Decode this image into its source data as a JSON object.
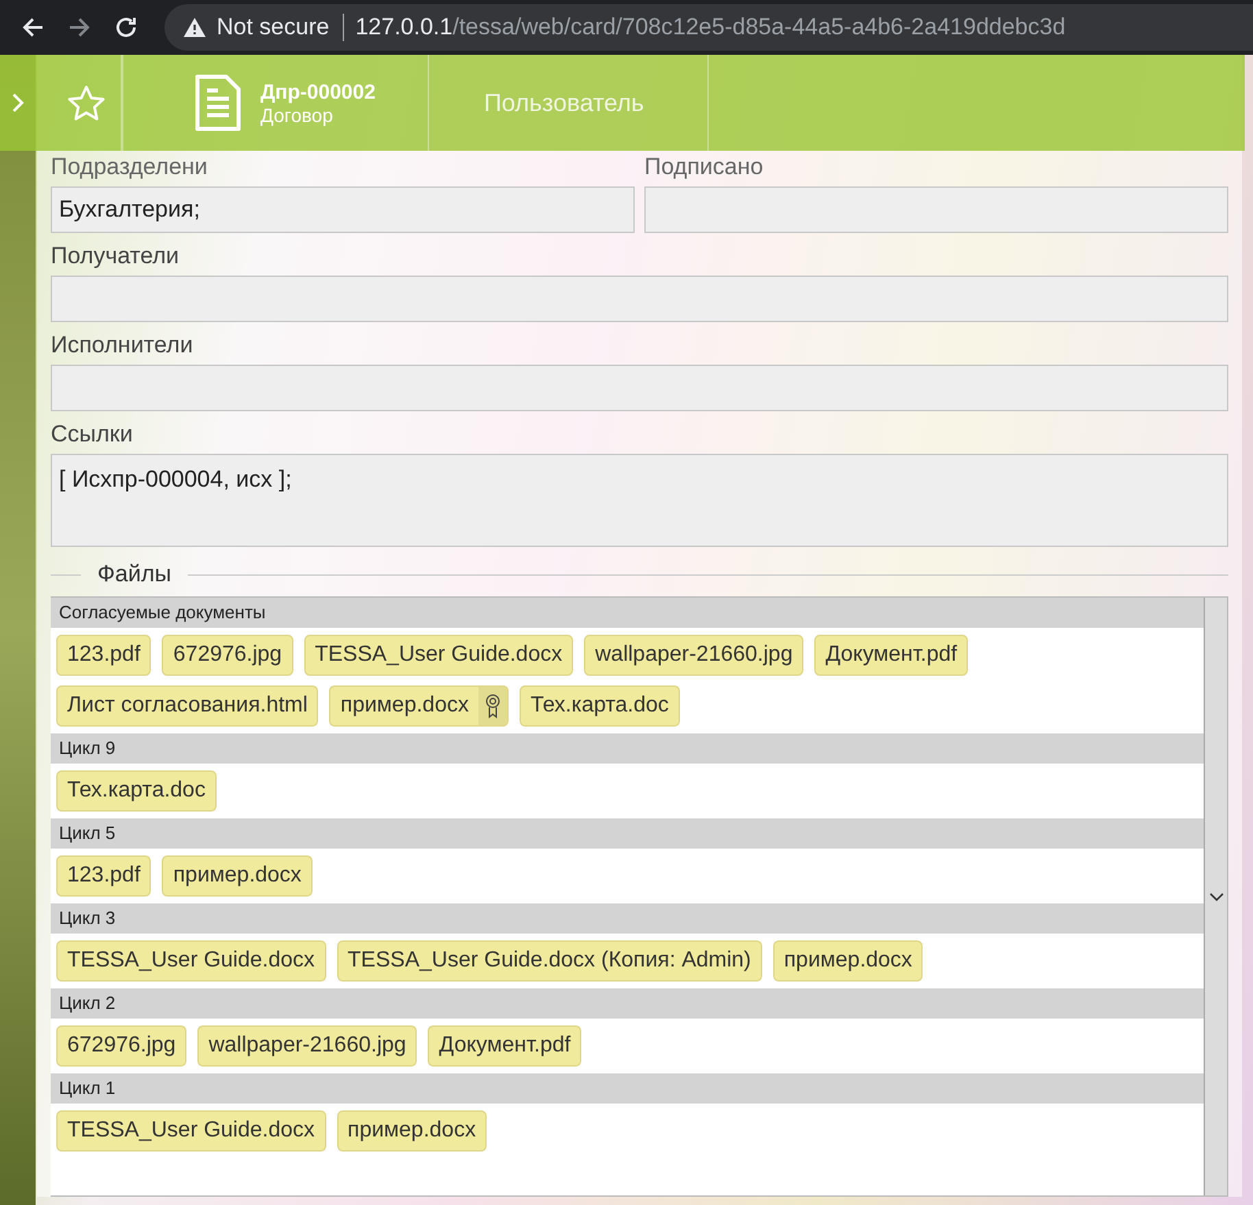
{
  "browser": {
    "security": "Not secure",
    "url_host": "127.0.0.1",
    "url_path": "/tessa/web/card/708c12e5-d85a-44a5-a4b6-2a419ddebc3d"
  },
  "toolbar": {
    "doc_number": "Дпр-000002",
    "doc_type": "Договор",
    "user": "Пользователь"
  },
  "top_fields": [
    {
      "label": "Подразделени",
      "value": "Бухгалтерия;"
    },
    {
      "label": "Подписано"
    }
  ],
  "fields": [
    {
      "label": "Получатели",
      "kind": "line"
    },
    {
      "label": "Исполнители",
      "kind": "line"
    },
    {
      "label": "Ссылки",
      "kind": "tall",
      "value": "[ Исхпр-000004, исх ];"
    }
  ],
  "files": {
    "title": "Файлы",
    "groups": [
      {
        "name": "Согласуемые документы",
        "files": [
          {
            "name": "123.pdf",
            "signed": false
          },
          {
            "name": "672976.jpg",
            "signed": false
          },
          {
            "name": "TESSA_User Guide.docx",
            "signed": false
          },
          {
            "name": "wallpaper-21660.jpg",
            "signed": false
          },
          {
            "name": "Документ.pdf",
            "signed": false
          },
          {
            "name": "Лист согласования.html",
            "signed": false
          },
          {
            "name": "пример.docx",
            "signed": true
          },
          {
            "name": "Тех.карта.doc",
            "signed": false
          }
        ]
      },
      {
        "name": "Цикл 9",
        "files": [
          {
            "name": "Тех.карта.doc",
            "signed": false
          }
        ]
      },
      {
        "name": "Цикл 5",
        "files": [
          {
            "name": "123.pdf",
            "signed": false
          },
          {
            "name": "пример.docx",
            "signed": false
          }
        ]
      },
      {
        "name": "Цикл 3",
        "files": [
          {
            "name": "TESSA_User Guide.docx",
            "signed": false
          },
          {
            "name": "TESSA_User Guide.docx (Копия: Admin)",
            "signed": false
          },
          {
            "name": "пример.docx",
            "signed": false
          }
        ]
      },
      {
        "name": "Цикл 2",
        "files": [
          {
            "name": "672976.jpg",
            "signed": false
          },
          {
            "name": "wallpaper-21660.jpg",
            "signed": false
          },
          {
            "name": "Документ.pdf",
            "signed": false
          }
        ]
      },
      {
        "name": "Цикл 1",
        "files": [
          {
            "name": "TESSA_User Guide.docx",
            "signed": false
          },
          {
            "name": "пример.docx",
            "signed": false
          }
        ]
      }
    ]
  }
}
